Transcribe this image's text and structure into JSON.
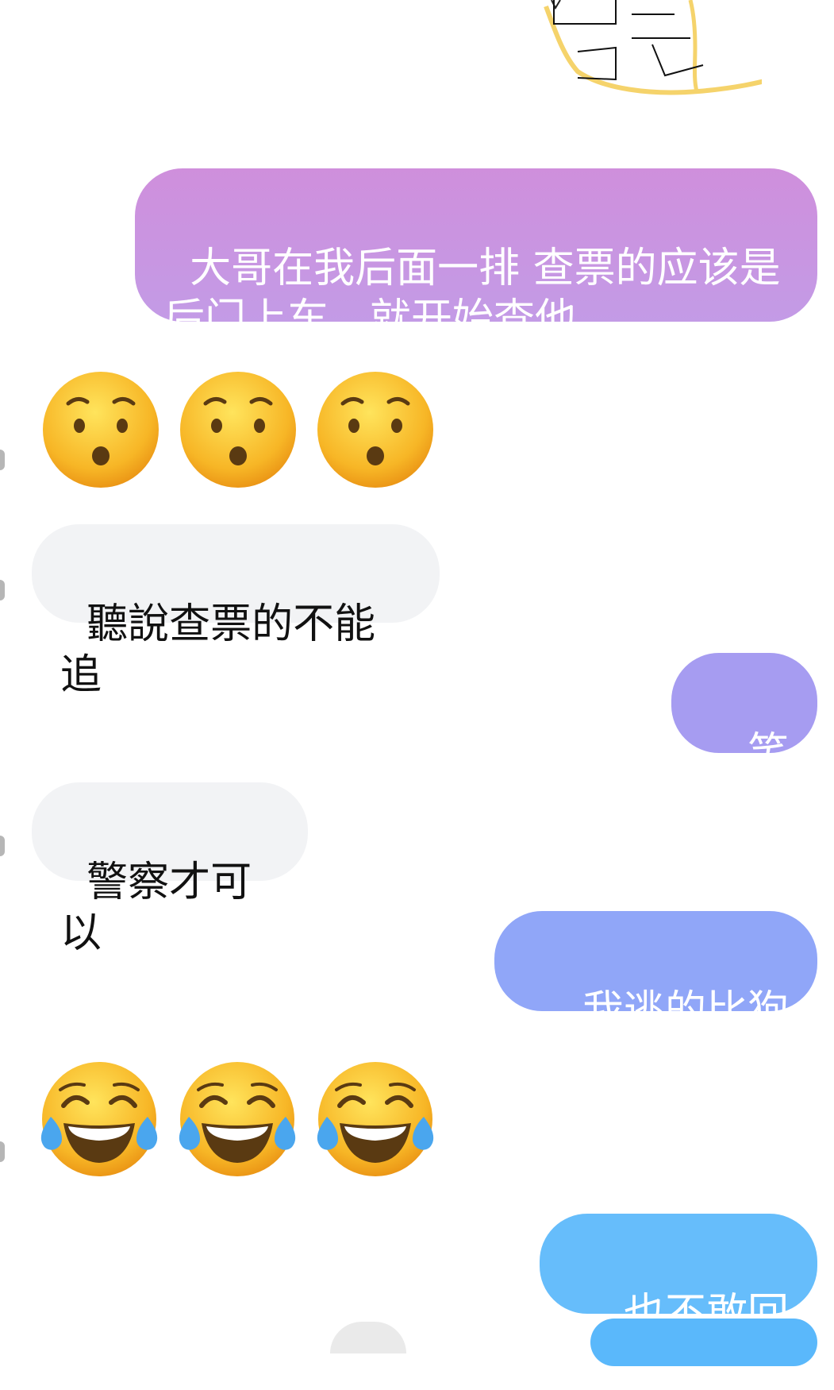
{
  "messages": [
    {
      "id": "m1",
      "direction": "out",
      "text": "大哥在我后面一排 查票的应该是\n后门上车，就开始查他"
    },
    {
      "id": "m2",
      "direction": "in",
      "emoji": "hushed-face",
      "count": 3
    },
    {
      "id": "m3",
      "direction": "in",
      "text": "聽說查票的不能追"
    },
    {
      "id": "m4",
      "direction": "out",
      "text": "笑死"
    },
    {
      "id": "m5",
      "direction": "in",
      "text": "警察才可以"
    },
    {
      "id": "m6",
      "direction": "out",
      "text": "我逃的比狗快"
    },
    {
      "id": "m7",
      "direction": "in",
      "emoji": "face-with-tears-of-joy",
      "count": 3
    },
    {
      "id": "m8",
      "direction": "out",
      "text": "也不敢回头"
    }
  ],
  "colors": {
    "incoming_bg": "#f2f3f5",
    "outgoing_purple": "#cf8fdc",
    "outgoing_violet": "#a69cf1",
    "outgoing_periwinkle": "#90a6f8",
    "outgoing_blue": "#66bdfb",
    "emoji_yellow": "#f7b626",
    "tear_blue": "#4aa6ee"
  }
}
